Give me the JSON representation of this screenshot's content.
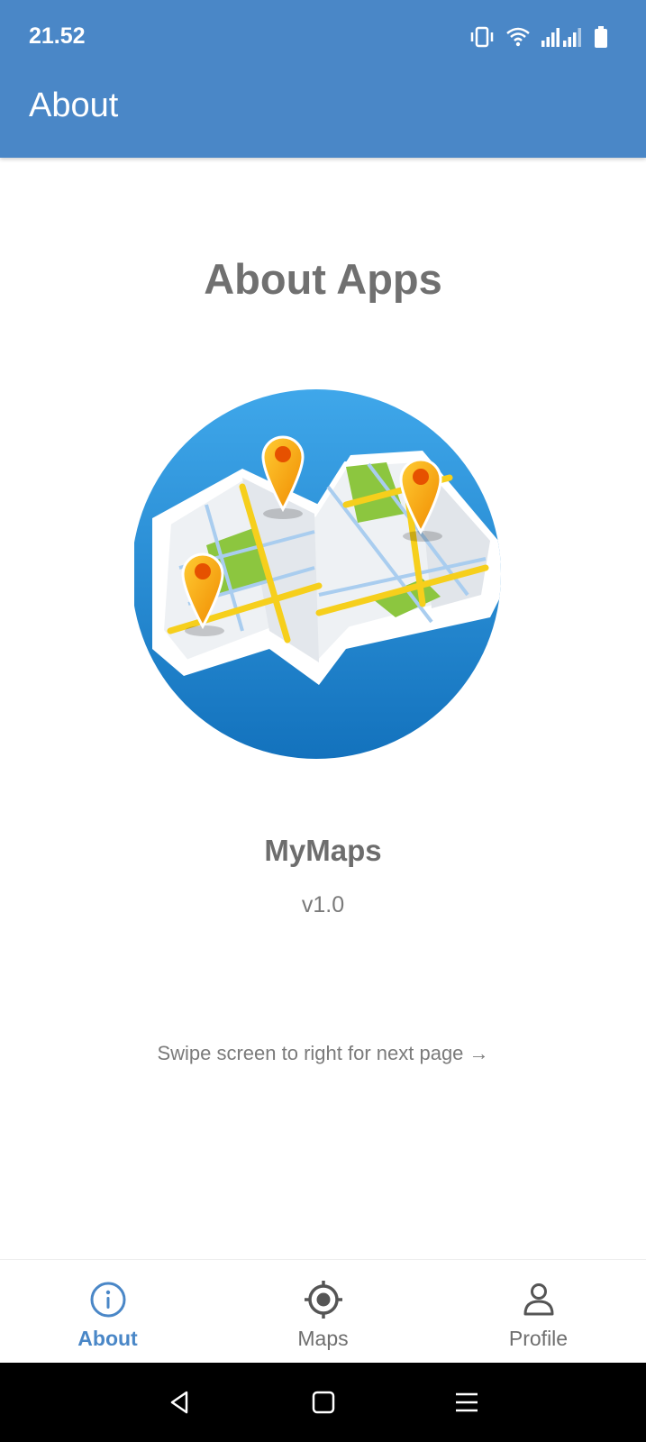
{
  "status_bar": {
    "time": "21.52",
    "icons": [
      "vibrate-icon",
      "wifi-icon",
      "signal-icon",
      "signal-icon",
      "battery-icon"
    ]
  },
  "app_bar": {
    "title": "About"
  },
  "content": {
    "title": "About Apps",
    "illustration": "map-with-pins-illustration",
    "app_name": "MyMaps",
    "version": "v1.0",
    "hint": "Swipe screen to right for next page →"
  },
  "bottom_nav": {
    "items": [
      {
        "label": "About",
        "icon": "info-icon",
        "active": true
      },
      {
        "label": "Maps",
        "icon": "location-target-icon",
        "active": false
      },
      {
        "label": "Profile",
        "icon": "person-icon",
        "active": false
      }
    ]
  },
  "system_nav": {
    "buttons": [
      "back-icon",
      "home-icon",
      "menu-icon"
    ]
  },
  "colors": {
    "primary": "#4a87c7",
    "text_gray": "#707070",
    "map_blue": "#1f8ad6",
    "pin_orange": "#f7a21a",
    "road_yellow": "#f6cf1c",
    "park_green": "#8cc63f"
  }
}
